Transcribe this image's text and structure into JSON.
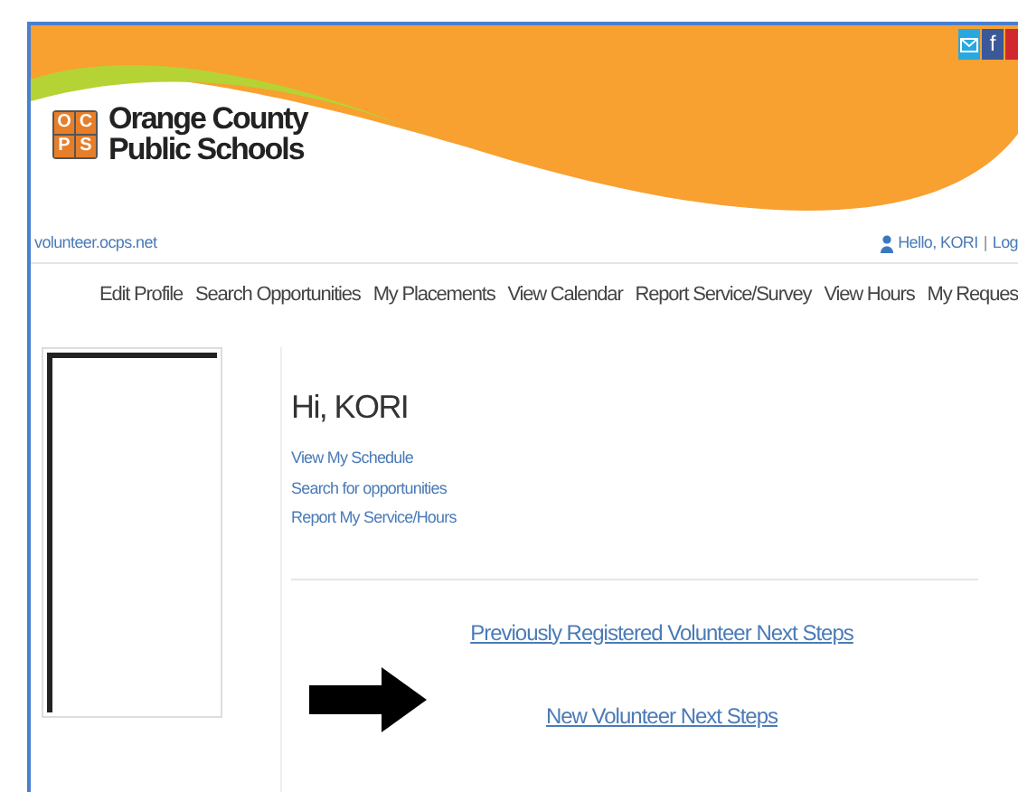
{
  "social": [
    {
      "kind": "mail"
    },
    {
      "kind": "facebook",
      "label": "f"
    },
    {
      "kind": "other"
    }
  ],
  "logo": {
    "letters": [
      "O",
      "C",
      "P",
      "S"
    ],
    "name_line_1": "Orange County",
    "name_line_2": "Public Schools"
  },
  "site_link": "volunteer.ocps.net",
  "user": {
    "greeting": "Hello, KORI",
    "separator": "|",
    "logout": "Log"
  },
  "nav": [
    "Edit Profile",
    "Search Opportunities",
    "My Placements",
    "View Calendar",
    "Report Service/Survey",
    "View Hours",
    "My Reques"
  ],
  "greeting": "Hi, KORI",
  "quick_links": [
    "View My Schedule",
    "Search for opportunities",
    "Report My Service/Hours"
  ],
  "next_steps": [
    "Previously Registered Volunteer Next Steps",
    "New Volunteer Next Steps"
  ]
}
